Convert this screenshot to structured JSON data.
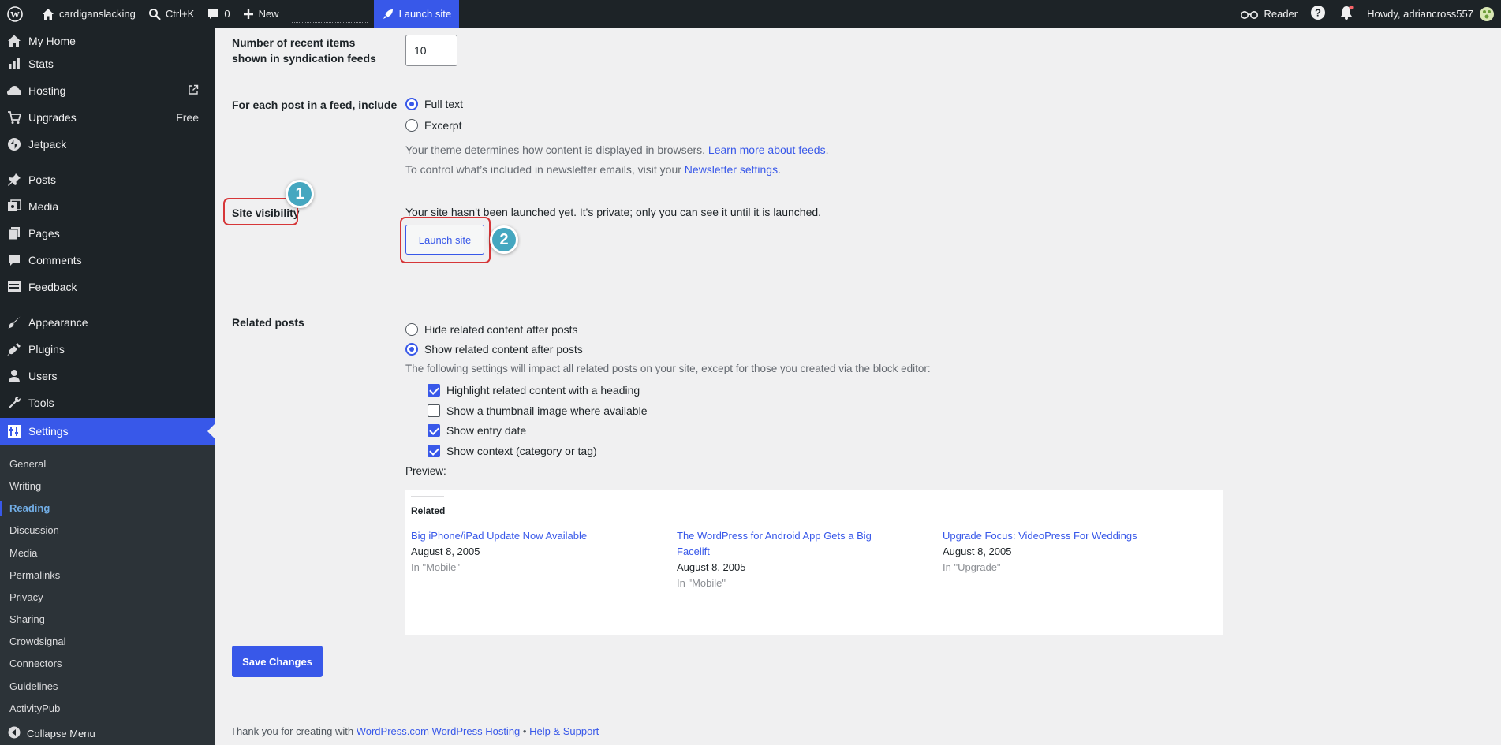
{
  "adminbar": {
    "site_name": "cardigans​lacking",
    "search_shortcut": "Ctrl+K",
    "comments_count": "0",
    "new_label": "New",
    "launch_label": "Launch site",
    "reader_label": "Reader",
    "howdy": "Howdy, adriancross557"
  },
  "sidebar": {
    "items": [
      {
        "label": "My Home",
        "icon": "home-icon"
      },
      {
        "label": "Stats",
        "icon": "bar-chart-icon"
      },
      {
        "label": "Hosting",
        "icon": "cloud-icon",
        "extra_icon": "external-link-icon"
      },
      {
        "label": "Upgrades",
        "icon": "cart-icon",
        "extra": "Free"
      },
      {
        "label": "Jetpack",
        "icon": "bolt-icon"
      },
      {
        "label": "Posts",
        "icon": "pin-icon"
      },
      {
        "label": "Media",
        "icon": "media-icon"
      },
      {
        "label": "Pages",
        "icon": "pages-icon"
      },
      {
        "label": "Comments",
        "icon": "speech-bubble-icon"
      },
      {
        "label": "Feedback",
        "icon": "feedback-icon"
      },
      {
        "label": "Appearance",
        "icon": "brush-icon"
      },
      {
        "label": "Plugins",
        "icon": "plug-icon"
      },
      {
        "label": "Users",
        "icon": "user-icon"
      },
      {
        "label": "Tools",
        "icon": "wrench-icon"
      },
      {
        "label": "Settings",
        "icon": "settings-icon"
      }
    ],
    "submenu": [
      "General",
      "Writing",
      "Reading",
      "Discussion",
      "Media",
      "Permalinks",
      "Privacy",
      "Sharing",
      "Crowdsignal",
      "Connectors",
      "Guidelines",
      "ActivityPub"
    ],
    "collapse_label": "Collapse Menu"
  },
  "settings": {
    "feed_items_label": "Number of recent items shown in syndication feeds",
    "feed_items_value": "10",
    "feed_include_label": "For each post in a feed, include",
    "feed_include_options": [
      "Full text",
      "Excerpt"
    ],
    "feed_desc1_text": "Your theme determines how content is displayed in browsers.",
    "feed_desc1_link": "Learn more about feeds",
    "feed_desc2_text": "To control what’s included in newsletter emails, visit your",
    "feed_desc2_link": "Newsletter settings",
    "visibility_label": "Site visibility",
    "visibility_text": "Your site hasn't been launched yet. It's private; only you can see it until it is launched.",
    "launch_button": "Launch site",
    "related_label": "Related posts",
    "related_options": [
      "Hide related content after posts",
      "Show related content after posts"
    ],
    "related_desc": "The following settings will impact all related posts on your site, except for those you created via the block editor:",
    "related_checks": [
      {
        "label": "Highlight related content with a heading",
        "checked": true
      },
      {
        "label": "Show a thumbnail image where available",
        "checked": false
      },
      {
        "label": "Show entry date",
        "checked": true
      },
      {
        "label": "Show context (category or tag)",
        "checked": true
      }
    ],
    "preview_label": "Preview:",
    "preview": {
      "heading": "Related",
      "posts": [
        {
          "title": "Big iPhone/iPad Update Now Available",
          "date": "August 8, 2005",
          "context": "In \"Mobile\""
        },
        {
          "title": "The WordPress for Android App Gets a Big Facelift",
          "date": "August 8, 2005",
          "context": "In \"Mobile\""
        },
        {
          "title": "Upgrade Focus: VideoPress For Weddings",
          "date": "August 8, 2005",
          "context": "In \"Upgrade\""
        }
      ]
    },
    "save_button": "Save Changes"
  },
  "footer": {
    "text": "Thank you for creating with",
    "link1": "WordPress.com WordPress Hosting",
    "sep": "•",
    "link2": "Help & Support"
  },
  "annotations": [
    "1",
    "2"
  ],
  "colors": {
    "accent": "#3858e9",
    "annotation_red": "#d63638",
    "badge": "#45a7c0"
  }
}
